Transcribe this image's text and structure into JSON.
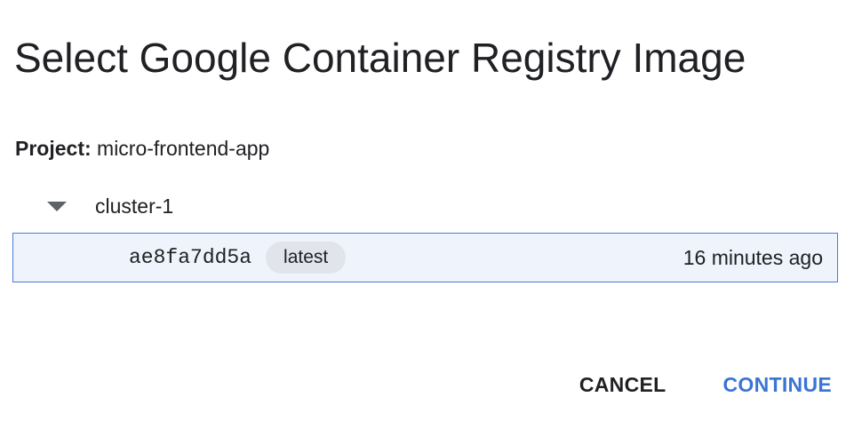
{
  "dialog": {
    "title": "Select Google Container Registry Image"
  },
  "project": {
    "label": "Project:",
    "value": "micro-frontend-app"
  },
  "tree": {
    "node_label": "cluster-1",
    "images": [
      {
        "digest": "ae8fa7dd5a",
        "tag": "latest",
        "time": "16 minutes ago"
      }
    ]
  },
  "actions": {
    "cancel_label": "CANCEL",
    "continue_label": "CONTINUE"
  },
  "colors": {
    "accent": "#3b74d4",
    "selected_row_bg": "#eef3fc",
    "selected_row_border": "#4a7cd8",
    "tag_bg": "#e1e4ea"
  }
}
